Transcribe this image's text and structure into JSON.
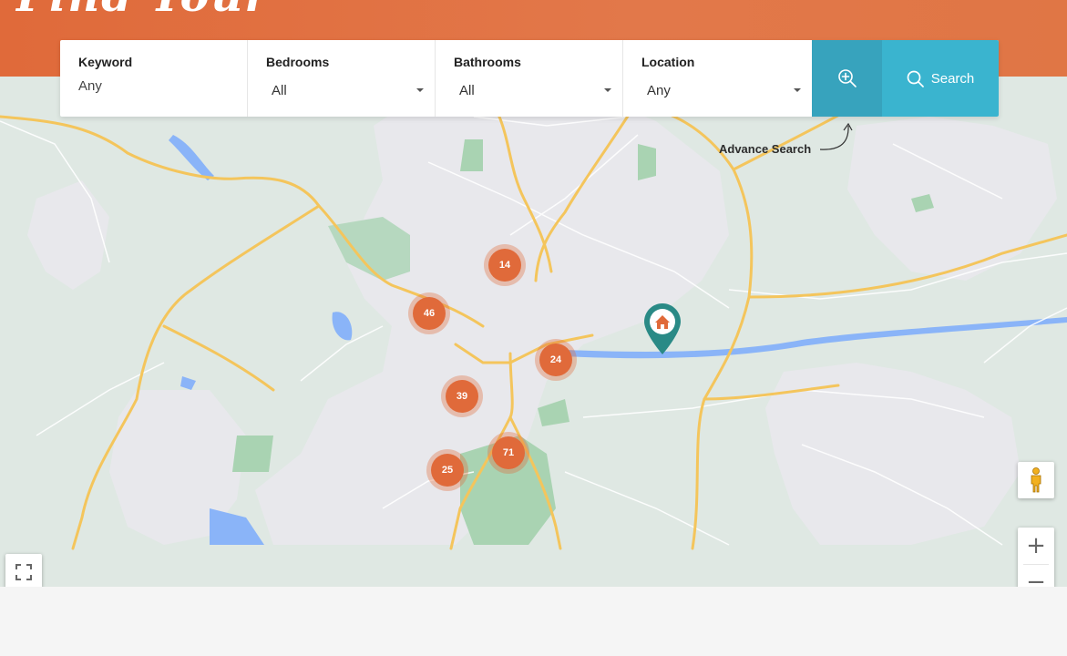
{
  "hero": {
    "title": "Find Your"
  },
  "search": {
    "fields": [
      {
        "label": "Keyword",
        "placeholder": "Any"
      },
      {
        "label": "Bedrooms",
        "value": "All"
      },
      {
        "label": "Bathrooms",
        "value": "All"
      },
      {
        "label": "Location",
        "value": "Any"
      }
    ],
    "search_label": "Search",
    "advance_label": "Advance Search"
  },
  "map": {
    "clusters": [
      {
        "count": "14"
      },
      {
        "count": "46"
      },
      {
        "count": "24"
      },
      {
        "count": "39"
      },
      {
        "count": "71"
      },
      {
        "count": "25"
      }
    ],
    "zoom_in": "+",
    "zoom_out": "−"
  },
  "colors": {
    "accent": "#e06a3a",
    "search_button": "#3ab4cf",
    "advance_button": "#37a3bd",
    "pin": "#2a8a86"
  },
  "icons": [
    "zoom-in-icon",
    "search-icon",
    "home-pin-icon",
    "pegman-icon",
    "fullscreen-icon"
  ]
}
